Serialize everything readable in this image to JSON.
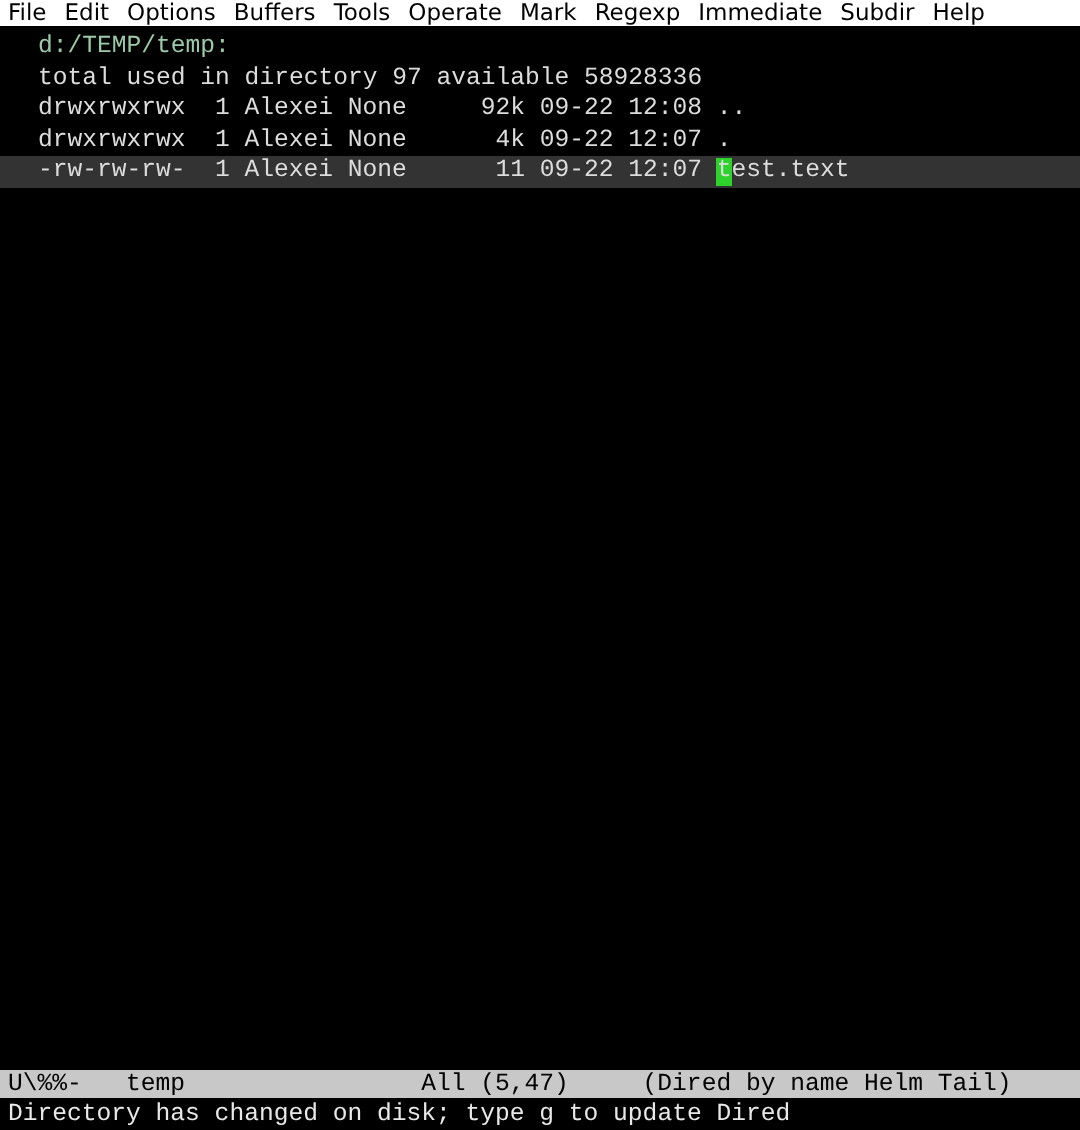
{
  "menu_bar": [
    "File",
    "Edit",
    "Options",
    "Buffers",
    "Tools",
    "Operate",
    "Mark",
    "Regexp",
    "Immediate",
    "Subdir",
    "Help"
  ],
  "buffer": {
    "directory": "d:/TEMP/temp:",
    "summary": "total used in directory 97 available 58928336",
    "entries": [
      {
        "mode": "drwxrwxrwx",
        "links": "1",
        "owner": "Alexei",
        "group": "None",
        "size": "92k",
        "date": "09-22",
        "time": "12:08",
        "name": "..",
        "selected": false
      },
      {
        "mode": "drwxrwxrwx",
        "links": "1",
        "owner": "Alexei",
        "group": "None",
        "size": "4k",
        "date": "09-22",
        "time": "12:07",
        "name": ".",
        "selected": false
      },
      {
        "mode": "-rw-rw-rw-",
        "links": "1",
        "owner": "Alexei",
        "group": "None",
        "size": "11",
        "date": "09-22",
        "time": "12:07",
        "name": "test.text",
        "selected": true
      }
    ]
  },
  "mode_line": {
    "status": "U\\%%-",
    "buffer_name": "temp",
    "position": "All (5,47)",
    "modes": "(Dired by name Helm Tail)"
  },
  "echo_area": "Directory has changed on disk; type g to update Dired"
}
